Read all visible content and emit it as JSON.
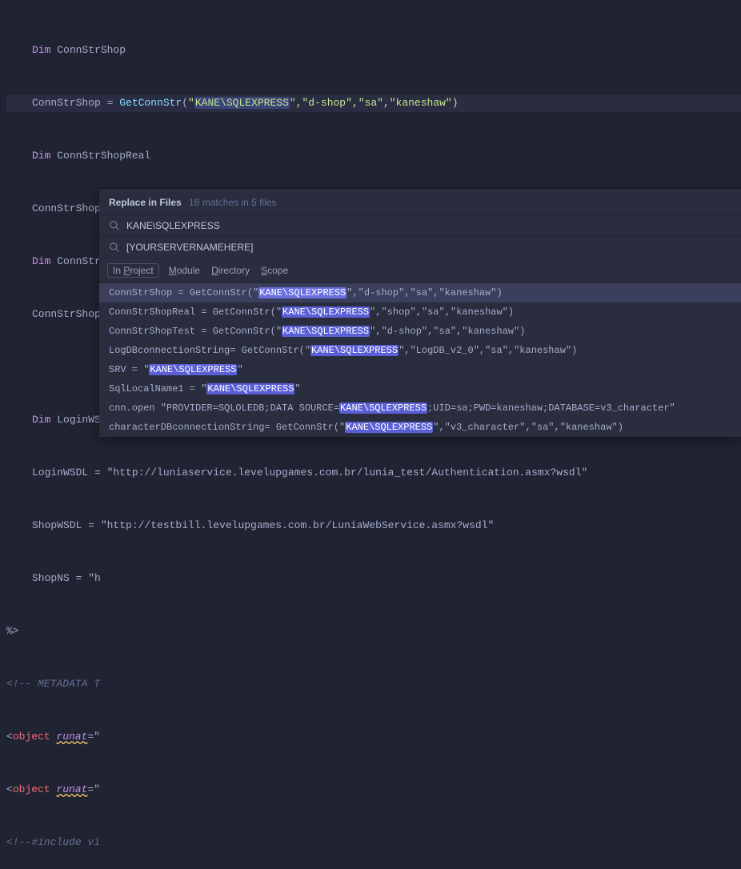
{
  "colors": {
    "selection": "#3b4578",
    "match": "#5a5fd6"
  },
  "code": {
    "l1_a": "Dim",
    "l1_b": "ConnStrShop",
    "l2_a": "ConnStrShop = ",
    "l2_fn": "GetConnStr",
    "l2_p1": "KANE\\SQLEXPRESS",
    "l2_rest": ",\"d-shop\",\"sa\",\"kaneshaw\")",
    "l3_a": "Dim",
    "l3_b": "ConnStrShopReal",
    "l4": "ConnStrShopReal = GetConnStr(\"KANE\\SQLEXPRESS\",\"shop\",\"sa\",\"kaneshaw\")",
    "l5_a": "Dim",
    "l5_b": "ConnStrShopTest",
    "l6": "ConnStrShopTest = GetConnStr(\"KANE\\SQLEXPRESS\",\"d-shop\",\"sa\",\"kaneshaw\")",
    "l8_a": "Dim",
    "l8_b": "LoginWSDL,ShopWSDL,ShopNS",
    "l9": "LoginWSDL = \"http://luniaservice.levelupgames.com.br/lunia_test/Authentication.asmx?wsdl\"",
    "l10": "ShopWSDL = \"http://testbill.levelupgames.com.br/LuniaWebService.asmx?wsdl\"",
    "l11": "ShopNS = \"h",
    "l12": "%>",
    "l13": "<!-- METADATA T",
    "l14_a": "object",
    "l14_b": "runat",
    "l14_c": "=\"",
    "l15_a": "object",
    "l15_b": "runat",
    "l15_c": "=\"",
    "l16": "<!--#include vi"
  },
  "panel": {
    "title": "Replace in Files",
    "sub": "18 matches in 5 files",
    "search": "KANE\\SQLEXPRESS",
    "replace": "[YOURSERVERNAMEHERE]",
    "scope": {
      "project": "In Project",
      "module": "Module",
      "directory": "Directory",
      "scope": "Scope"
    },
    "results": [
      {
        "pre": "ConnStrShop = GetConnStr(\"",
        "m": "KANE\\SQLEXPRESS",
        "post": "\",\"d-shop\",\"sa\",\"kaneshaw\")",
        "selected": true
      },
      {
        "pre": "ConnStrShopReal = GetConnStr(\"",
        "m": "KANE\\SQLEXPRESS",
        "post": "\",\"shop\",\"sa\",\"kaneshaw\")"
      },
      {
        "pre": "ConnStrShopTest = GetConnStr(\"",
        "m": "KANE\\SQLEXPRESS",
        "post": "\",\"d-shop\",\"sa\",\"kaneshaw\")"
      },
      {
        "pre": "LogDBconnectionString= GetConnStr(\"",
        "m": "KANE\\SQLEXPRESS",
        "post": "\",\"LogDB_v2_0\",\"sa\",\"kaneshaw\")"
      },
      {
        "pre": "  SRV = \"",
        "m": "KANE\\SQLEXPRESS",
        "post": "\""
      },
      {
        "pre": "  SqlLocalName1 = \"",
        "m": "KANE\\SQLEXPRESS",
        "post": "\""
      },
      {
        "pre": "cnn.open \"PROVIDER=SQLOLEDB;DATA SOURCE=",
        "m": "KANE\\SQLEXPRESS",
        "post": ";UID=sa;PWD=kaneshaw;DATABASE=v3_character\""
      },
      {
        "pre": "characterDBconnectionString= GetConnStr(\"",
        "m": "KANE\\SQLEXPRESS",
        "post": "\",\"v3_character\",\"sa\",\"kaneshaw\")"
      }
    ]
  }
}
